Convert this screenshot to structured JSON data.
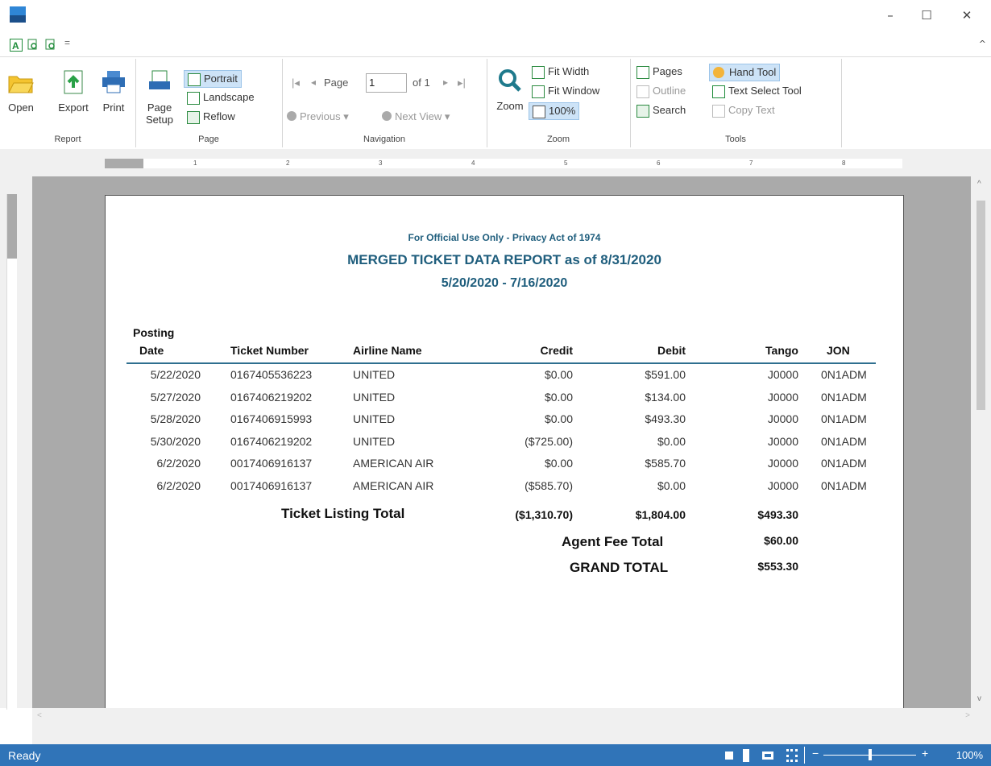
{
  "window": {
    "minimize": "–",
    "maximize": "☐",
    "close": "✕"
  },
  "qat": {
    "dropdown": "="
  },
  "ribbon": {
    "groups": {
      "report": "Report",
      "page": "Page",
      "navigation": "Navigation",
      "zoom": "Zoom",
      "tools": "Tools"
    },
    "report": {
      "open": "Open",
      "export": "Export",
      "print": "Print"
    },
    "page": {
      "setup_line1": "Page",
      "setup_line2": "Setup",
      "portrait": "Portrait",
      "landscape": "Landscape",
      "reflow": "Reflow"
    },
    "navigation": {
      "page_label": "Page",
      "page_value": "1",
      "of_label": "of 1",
      "previous": "Previous",
      "next": "Next View"
    },
    "zoom": {
      "zoom": "Zoom",
      "fit_width": "Fit Width",
      "fit_window": "Fit Window",
      "hundred": "100%"
    },
    "tools": {
      "pages": "Pages",
      "outline": "Outline",
      "search": "Search",
      "hand_tool": "Hand Tool",
      "text_select": "Text Select Tool",
      "copy_text": "Copy Text"
    }
  },
  "ruler": {
    "ticks": [
      "1",
      "2",
      "3",
      "4",
      "5",
      "6",
      "7",
      "8"
    ]
  },
  "report": {
    "banner": "For Official Use Only - Privacy Act of 1974",
    "title": "MERGED TICKET DATA REPORT as of 8/31/2020",
    "range": "5/20/2020 - 7/16/2020",
    "headers": {
      "posting_line1": "Posting",
      "posting_line2": "Date",
      "ticket": "Ticket Number",
      "airline": "Airline Name",
      "credit": "Credit",
      "debit": "Debit",
      "tango": "Tango",
      "jon": "JON"
    },
    "rows": [
      {
        "date": "5/22/2020",
        "ticket": "0167405536223",
        "airline": "UNITED",
        "credit": "$0.00",
        "debit": "$591.00",
        "tango": "J0000",
        "jon": "0N1ADM"
      },
      {
        "date": "5/27/2020",
        "ticket": "0167406219202",
        "airline": "UNITED",
        "credit": "$0.00",
        "debit": "$134.00",
        "tango": "J0000",
        "jon": "0N1ADM"
      },
      {
        "date": "5/28/2020",
        "ticket": "0167406915993",
        "airline": "UNITED",
        "credit": "$0.00",
        "debit": "$493.30",
        "tango": "J0000",
        "jon": "0N1ADM"
      },
      {
        "date": "5/30/2020",
        "ticket": "0167406219202",
        "airline": "UNITED",
        "credit": "($725.00)",
        "debit": "$0.00",
        "tango": "J0000",
        "jon": "0N1ADM"
      },
      {
        "date": "6/2/2020",
        "ticket": "0017406916137",
        "airline": "AMERICAN AIR",
        "credit": "$0.00",
        "debit": "$585.70",
        "tango": "J0000",
        "jon": "0N1ADM"
      },
      {
        "date": "6/2/2020",
        "ticket": "0017406916137",
        "airline": "AMERICAN AIR",
        "credit": "($585.70)",
        "debit": "$0.00",
        "tango": "J0000",
        "jon": "0N1ADM"
      }
    ],
    "ticket_total_label": "Ticket Listing Total",
    "ticket_total_credit": "($1,310.70)",
    "ticket_total_debit": "$1,804.00",
    "ticket_total_tango": "$493.30",
    "agent_fee_label": "Agent Fee Total",
    "agent_fee_value": "$60.00",
    "grand_total_label": "GRAND TOTAL",
    "grand_total_value": "$553.30"
  },
  "status": {
    "text": "Ready",
    "zoom_minus": "−",
    "zoom_plus": "+",
    "zoom": "100%"
  }
}
